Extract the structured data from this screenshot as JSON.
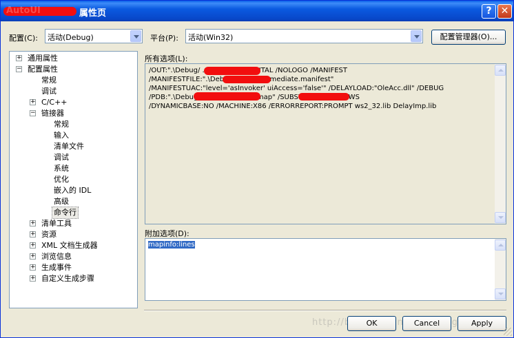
{
  "window": {
    "title_visible": "AutoUI",
    "title": "属性页",
    "help_glyph": "?",
    "close_glyph": "✕"
  },
  "config": {
    "label": "配置(C):",
    "value": "活动(Debug)",
    "platform_label": "平台(P):",
    "platform_value": "活动(Win32)",
    "manager_button": "配置管理器(O)..."
  },
  "tree": {
    "items": [
      {
        "label": "通用属性",
        "expander": "+"
      },
      {
        "label": "配置属性",
        "expander": "−"
      },
      {
        "label": "常规"
      },
      {
        "label": "调试"
      },
      {
        "label": "C/C++",
        "expander": "+"
      },
      {
        "label": "链接器",
        "expander": "−"
      },
      {
        "label": "常规"
      },
      {
        "label": "输入"
      },
      {
        "label": "清单文件"
      },
      {
        "label": "调试"
      },
      {
        "label": "系统"
      },
      {
        "label": "优化"
      },
      {
        "label": "嵌入的 IDL"
      },
      {
        "label": "高级"
      },
      {
        "label": "命令行",
        "selected": true
      },
      {
        "label": "清单工具",
        "expander": "+"
      },
      {
        "label": "资源",
        "expander": "+"
      },
      {
        "label": "XML 文档生成器",
        "expander": "+"
      },
      {
        "label": "浏览信息",
        "expander": "+"
      },
      {
        "label": "生成事件",
        "expander": "+"
      },
      {
        "label": "自定义生成步骤",
        "expander": "+"
      }
    ]
  },
  "all_options": {
    "label": "所有选项(L):",
    "lines": [
      "/OUT:\".\\Debug/                        .exe\" /INCREMENTAL /NOLOGO /MANIFEST",
      "/MANIFESTFILE:\".\\Debug\\                     .exe.intermediate.manifest\"",
      "/MANIFESTUAC:\"level='asInvoker' uiAccess='false'\" /DELAYLOAD:\"OleAcc.dll\" /DEBUG",
      "/PDB:\".\\Debug/                        .pdb\" /MAP:\"                   m.map\" /SUBSYSTEM:WINDOWS",
      "/DYNAMICBASE:NO /MACHINE:X86 /ERRORREPORT:PROMPT ws2_32.lib DelayImp.lib"
    ]
  },
  "additional_options": {
    "label": "附加选项(D):",
    "value": "mapinfo:lines"
  },
  "buttons": {
    "ok": "OK",
    "cancel": "Cancel",
    "apply": "Apply"
  },
  "watermark": "http://blog.csdn.net/cpplang"
}
